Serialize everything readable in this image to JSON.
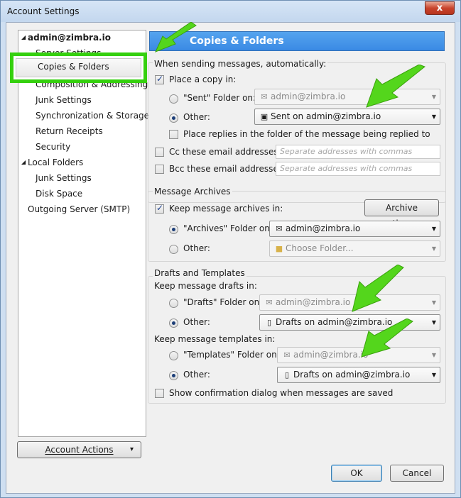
{
  "window": {
    "title": "Account Settings",
    "close_glyph": "x"
  },
  "tree": {
    "account": "admin@zimbra.io",
    "items": [
      "Server Settings",
      "Copies & Folders",
      "Composition & Addressing",
      "Junk Settings",
      "Synchronization & Storage",
      "Return Receipts",
      "Security"
    ],
    "local": "Local Folders",
    "local_items": [
      "Junk Settings",
      "Disk Space"
    ],
    "smtp": "Outgoing Server (SMTP)",
    "expand_glyph": "◢"
  },
  "account_actions": {
    "label": "Account Actions",
    "glyph": "▾"
  },
  "panel": {
    "title": "Copies & Folders"
  },
  "sending": {
    "legend": "When sending messages, automatically:",
    "place_copy": "Place a copy in:",
    "sent_folder_label": "\"Sent\" Folder on:",
    "sent_folder_value": "admin@zimbra.io",
    "other_label": "Other:",
    "other_value": "Sent on admin@zimbra.io",
    "replies_label": "Place replies in the folder of the message being replied to",
    "cc_label": "Cc these email addresses:",
    "bcc_label": "Bcc these email addresses:",
    "addr_placeholder": "Separate addresses with commas"
  },
  "archives": {
    "legend": "Message Archives",
    "keep_label": "Keep message archives in:",
    "options_button": "Archive options...",
    "folder_label": "\"Archives\" Folder on:",
    "folder_value": "admin@zimbra.io",
    "other_label": "Other:",
    "other_value": "Choose Folder..."
  },
  "drafts": {
    "legend": "Drafts and Templates",
    "drafts_heading": "Keep message drafts in:",
    "drafts_folder_label": "\"Drafts\" Folder on:",
    "drafts_folder_value": "admin@zimbra.io",
    "drafts_other_label": "Other:",
    "drafts_other_value": "Drafts on admin@zimbra.io",
    "templates_heading": "Keep message templates in:",
    "templates_folder_label": "\"Templates\" Folder on:",
    "templates_folder_value": "admin@zimbra.io",
    "templates_other_label": "Other:",
    "templates_other_value": "Drafts on admin@zimbra.io",
    "confirm_label": "Show confirmation dialog when messages are saved"
  },
  "footer": {
    "ok": "OK",
    "cancel": "Cancel"
  },
  "colors": {
    "highlight": "#35d00e",
    "header": "#3a8ae4",
    "arrow": "#54d61c"
  }
}
